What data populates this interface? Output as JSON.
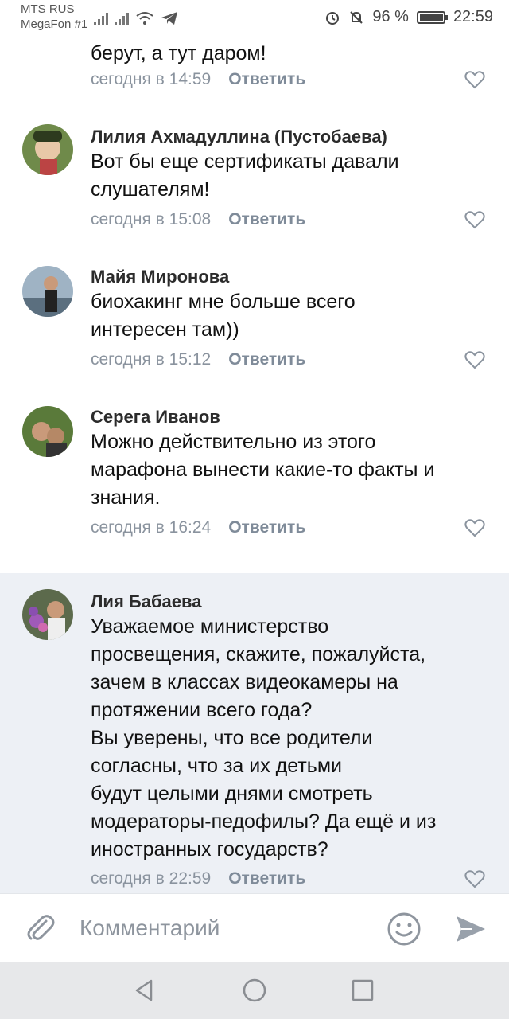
{
  "status_bar": {
    "carrier_1": "MTS RUS",
    "carrier_2": "MegaFon #1",
    "battery": "96 %",
    "time": "22:59"
  },
  "comments": [
    {
      "author": "",
      "text": "берут, а тут даром!",
      "time": "сегодня в 14:59",
      "reply": "Ответить"
    },
    {
      "author": "Лилия Ахмадуллина (Пустобаева)",
      "text": "Вот бы еще сертификаты давали\nслушателям!",
      "time": "сегодня в 15:08",
      "reply": "Ответить"
    },
    {
      "author": "Майя Миронова",
      "text": "биохакинг мне больше всего\nинтересен там))",
      "time": "сегодня в 15:12",
      "reply": "Ответить"
    },
    {
      "author": "Серега Иванов",
      "text": "Можно действительно из этого\nмарафона вынести какие-то факты и\nзнания.",
      "time": "сегодня в 16:24",
      "reply": "Ответить"
    },
    {
      "author": "Лия Бабаева",
      "text": "Уважаемое министерство\nпросвещения, скажите, пожалуйста,\nзачем в классах видеокамеры на\nпротяжении всего года?\nВы уверены, что все родители\nсогласны, что за их детьми\nбудут целыми днями смотреть\nмодераторы-педофилы? Да ещё и из\nиностранных государств?",
      "time": "сегодня в 22:59",
      "reply": "Ответить"
    }
  ],
  "input": {
    "placeholder": "Комментарий"
  },
  "icons": {
    "attach": "paperclip-icon",
    "emoji": "smile-icon",
    "send": "send-icon",
    "like": "heart-icon",
    "nav_back": "triangle-back-icon",
    "nav_home": "circle-home-icon",
    "nav_recent": "square-recent-icon"
  },
  "colors": {
    "highlight_bg": "#edf0f5",
    "meta_text": "#8a939e",
    "nav_bar": "#e7e8ea"
  }
}
